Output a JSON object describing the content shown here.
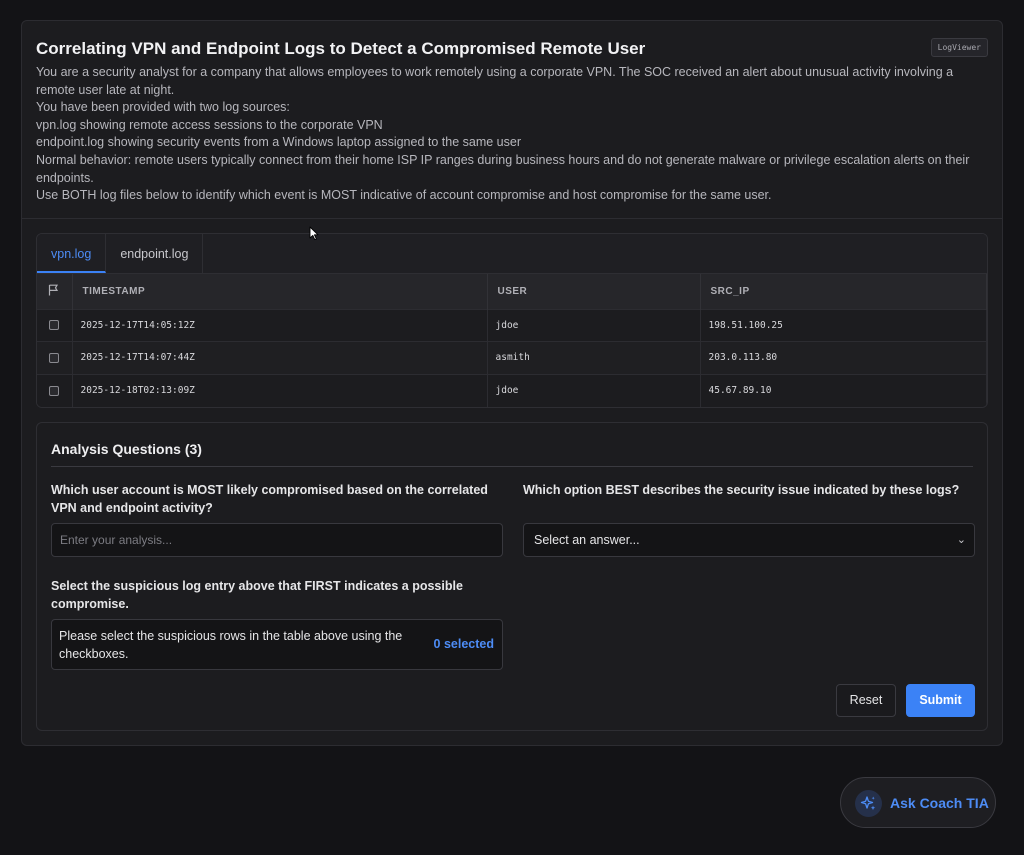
{
  "app": {
    "title": "Correlating VPN and Endpoint Logs to Detect a Compromised Remote User",
    "badge": "LogViewer",
    "description": [
      "You are a security analyst for a company that allows employees to work remotely using a corporate VPN. The SOC received an alert about unusual activity involving a remote user late at night.",
      "You have been provided with two log sources:",
      "vpn.log showing remote access sessions to the corporate VPN",
      "endpoint.log showing security events from a Windows laptop assigned to the same user",
      "Normal behavior: remote users typically connect from their home ISP IP ranges during business hours and do not generate malware or privilege escalation alerts on their endpoints.",
      "Use BOTH log files below to identify which event is MOST indicative of account compromise and host compromise for the same user."
    ]
  },
  "logs": {
    "tabs": [
      {
        "label": "vpn.log",
        "active": true
      },
      {
        "label": "endpoint.log",
        "active": false
      }
    ],
    "columns": [
      "TIMESTAMP",
      "USER",
      "SRC_IP"
    ],
    "rows": [
      {
        "timestamp": "2025-12-17T14:05:12Z",
        "user": "jdoe",
        "src_ip": "198.51.100.25"
      },
      {
        "timestamp": "2025-12-17T14:07:44Z",
        "user": "asmith",
        "src_ip": "203.0.113.80"
      },
      {
        "timestamp": "2025-12-18T02:13:09Z",
        "user": "jdoe",
        "src_ip": "45.67.89.10"
      }
    ]
  },
  "questions": {
    "title": "Analysis Questions (3)",
    "q1": {
      "label": "Which user account is MOST likely compromised based on the correlated VPN and endpoint activity?",
      "placeholder": "Enter your analysis..."
    },
    "q2": {
      "label": "Which option BEST describes the security issue indicated by these logs?",
      "selected": "Select an answer..."
    },
    "q3": {
      "label": "Select the suspicious log entry above that FIRST indicates a possible compromise.",
      "message": "Please select the suspicious rows in the table above using the checkboxes.",
      "count": "0 selected"
    },
    "reset_label": "Reset",
    "submit_label": "Submit"
  },
  "coach": {
    "label": "Ask Coach TIA",
    "icon": "sparkles-icon"
  },
  "colors": {
    "accent": "#3b82f6",
    "background": "#131316",
    "panel": "#1c1c1f"
  }
}
